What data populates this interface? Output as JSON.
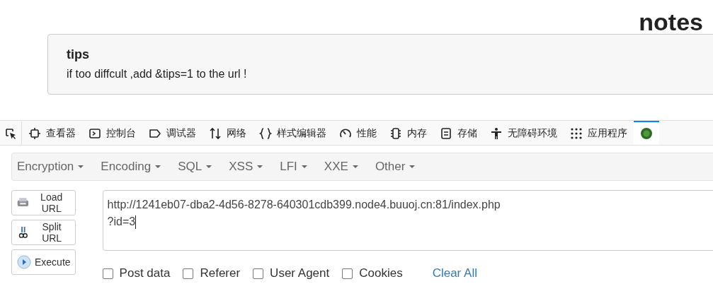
{
  "page": {
    "heading": "notes",
    "tips_card": {
      "title": "tips",
      "text": "if too diffcult ,add &tips=1 to the url !"
    }
  },
  "devtools": {
    "tabs": [
      {
        "kind": "picker",
        "selected": false
      },
      {
        "kind": "inspector",
        "label": "查看器",
        "selected": false
      },
      {
        "kind": "console",
        "label": "控制台",
        "selected": false
      },
      {
        "kind": "debugger",
        "label": "调试器",
        "selected": false
      },
      {
        "kind": "network",
        "label": "网络",
        "selected": false
      },
      {
        "kind": "style",
        "label": "样式编辑器",
        "selected": false
      },
      {
        "kind": "performance",
        "label": "性能",
        "selected": false
      },
      {
        "kind": "memory",
        "label": "内存",
        "selected": false
      },
      {
        "kind": "storage",
        "label": "存储",
        "selected": false
      },
      {
        "kind": "accessibility",
        "label": "无障碍环境",
        "selected": false
      },
      {
        "kind": "application",
        "label": "应用程序",
        "selected": false
      },
      {
        "kind": "extension",
        "selected": true
      }
    ]
  },
  "hackbar": {
    "menus": [
      "Encryption",
      "Encoding",
      "SQL",
      "XSS",
      "LFI",
      "XXE",
      "Other"
    ],
    "buttons": [
      {
        "kind": "load",
        "label": "Load URL"
      },
      {
        "kind": "split",
        "label": "Split URL"
      },
      {
        "kind": "execute",
        "label": "Execute"
      }
    ],
    "url_lines": [
      "http://1241eb07-dba2-4d56-8278-640301cdb399.node4.buuoj.cn:81/index.php",
      "?id=3"
    ],
    "options": [
      {
        "label": "Post data",
        "checked": false
      },
      {
        "label": "Referer",
        "checked": false
      },
      {
        "label": "User Agent",
        "checked": false
      },
      {
        "label": "Cookies",
        "checked": false
      }
    ],
    "clear_link": "Clear All"
  }
}
